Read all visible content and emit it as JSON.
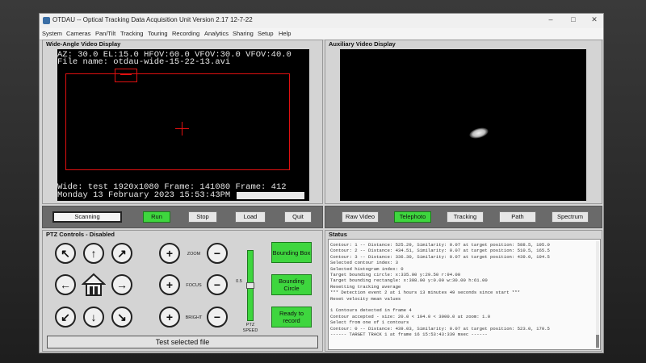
{
  "window": {
    "title": "OTDAU -- Optical Tracking Data Acquisition Unit   Version 2.17  12-7-22",
    "controls": [
      "–",
      "□",
      "✕"
    ]
  },
  "menu": [
    "System",
    "Cameras",
    "Pan/Tilt",
    "Tracking",
    "Touring",
    "Recording",
    "Analytics",
    "Sharing",
    "Setup",
    "Help"
  ],
  "wide_angle": {
    "title": "Wide-Angle Video Display",
    "overlay_line1": "AZ: 30.0  EL:15.0   HFOV:60.0  VFOV:30.0  VFOV:40.0",
    "overlay_line2": "File name: otdau-wide-15-22-13.avi",
    "overlay_line3": "Wide: test   1920x1080   Frame: 141080   Frame: 412",
    "overlay_line4": "Monday 13 February 2023 15:53:43PM",
    "buttons": [
      "Scanning",
      "Run",
      "Stop",
      "Load",
      "Quit"
    ]
  },
  "auxiliary": {
    "title": "Auxiliary Video Display",
    "buttons": [
      "Raw Video",
      "Telephoto",
      "Tracking",
      "Path",
      "Spectrum"
    ]
  },
  "ptz": {
    "title": "PTZ Controls - Disabled",
    "zoom_label": "ZOOM",
    "focus_label": "FOCUS",
    "bright_label": "BRIGHT",
    "speed_label_1": "PTZ",
    "speed_label_2": "SPEED",
    "speed_value": "0.5",
    "speed_level": 0.5,
    "plus": "+",
    "minus": "−",
    "arrows": {
      "nw": "↖",
      "n": "↑",
      "ne": "↗",
      "w": "←",
      "e": "→",
      "sw": "↙",
      "s": "↓",
      "se": "↘"
    },
    "bounding_box": "Bounding Box",
    "bounding_circle": "Bounding Circle",
    "ready_to_record": "Ready to record",
    "file_status": "Test selected file"
  },
  "status": {
    "title": "Status",
    "lines": [
      "Contour: 1 -- Distance: 525.29, Similarity: 0.07 at target position: 588.5, 195.0",
      "Contour: 2 -- Distance: 434.51, Similarity: 0.07 at target position: 510.5, 165.5",
      "Contour: 3 -- Distance: 336.30, Similarity: 0.07 at target position: 439.0, 194.5",
      "Selected contour index: 3",
      "Selected histogram index: 0",
      "Target bounding circle: x:335.00 y:29.50 r:94.00",
      "Target bounding rectangle: x:308.00 y:0.00 w:30.00 h:61.00",
      "Resetting tracking average",
      "*** Detection event 2 at 1 hours 13 minutes 49 seconds since start ***",
      "Reset velocity mean values",
      "",
      "1 Contours detected in frame 4",
      "Contour accepted - size: 20.0 < 194.0 < 3000.0 at zoom: 1.0",
      "Select from one of 1 contours",
      "Contour: 0 -- Distance: 439.03, Similarity: 0.07 at target position: 523.0, 170.5",
      "------  TARGET TRACK 1 at frame 16  15:53:43:339 msec  ------"
    ]
  }
}
